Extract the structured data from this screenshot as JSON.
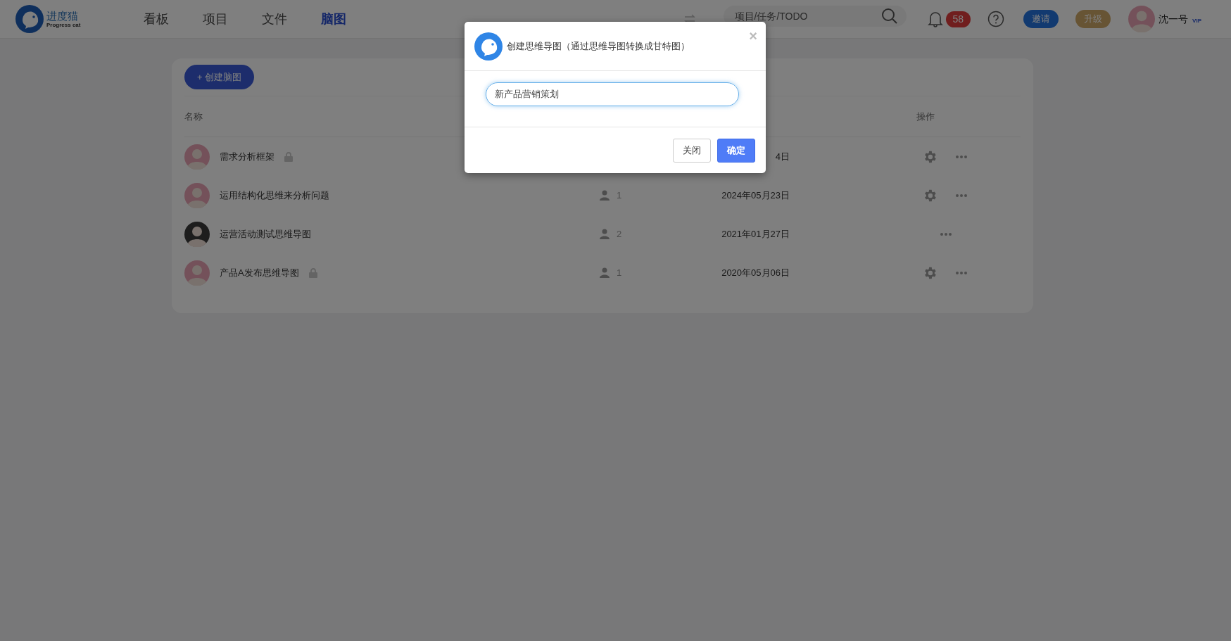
{
  "header": {
    "logo": {
      "name": "进度猫",
      "tagline": "Progress cat"
    },
    "nav": [
      {
        "label": "看板",
        "selected": false
      },
      {
        "label": "项目",
        "selected": false
      },
      {
        "label": "文件",
        "selected": false
      },
      {
        "label": "脑图",
        "selected": true
      }
    ],
    "search": {
      "placeholder": "项目/任务/TODO"
    },
    "notifications": "58",
    "invite": "邀请",
    "upgrade": "升级",
    "user": {
      "name": "沈一号",
      "badge": "VIP"
    }
  },
  "create_button": "+ 创建脑图",
  "table": {
    "columns": [
      "名称",
      "操作"
    ],
    "rows": [
      {
        "name": "需求分析框架",
        "locked": true,
        "kind": "girl",
        "members": null,
        "date": "4日",
        "settings": true
      },
      {
        "name": "运用结构化思维来分析问题",
        "locked": false,
        "kind": "girl",
        "members": "1",
        "date": "2024年05月23日",
        "settings": true
      },
      {
        "name": "运营活动测试思维导图",
        "locked": false,
        "kind": "man",
        "members": "2",
        "date": "2021年01月27日",
        "settings": false
      },
      {
        "name": "产品A发布思维导图",
        "locked": true,
        "kind": "girl",
        "members": "1",
        "date": "2020年05月06日",
        "settings": true
      }
    ]
  },
  "dialog": {
    "title": "创建思维导图（通过思维导图转换成甘特图）",
    "close": "×",
    "value": "新产品营销策划",
    "buttons": [
      {
        "label": "关闭",
        "kind": "secondary"
      },
      {
        "label": "确定",
        "kind": "primary"
      }
    ]
  }
}
